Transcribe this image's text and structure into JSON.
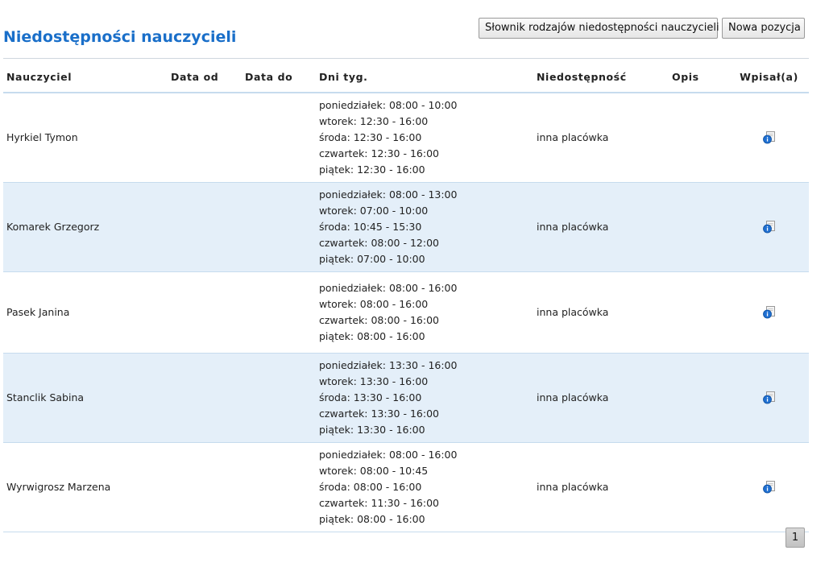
{
  "page": {
    "title": "Niedostępności nauczycieli"
  },
  "toolbar": {
    "dictionary_label": "Słownik rodzajów niedostępności nauczycieli",
    "new_label": "Nowa pozycja"
  },
  "table": {
    "headers": [
      "Nauczyciel",
      "Data od",
      "Data do",
      "Dni tyg.",
      "Niedostępność",
      "Opis",
      "Wpisał(a)"
    ],
    "rows": [
      {
        "teacher": "Hyrkiel Tymon",
        "date_from": "",
        "date_to": "",
        "days": [
          "poniedziałek: 08:00 - 10:00",
          "wtorek: 12:30 - 16:00",
          "środa: 12:30 - 16:00",
          "czwartek: 12:30 - 16:00",
          "piątek: 12:30 - 16:00"
        ],
        "unavailability": "inna placówka",
        "description": "",
        "entered_by_icon": "info-icon"
      },
      {
        "teacher": "Komarek Grzegorz",
        "date_from": "",
        "date_to": "",
        "days": [
          "poniedziałek: 08:00 - 13:00",
          "wtorek: 07:00 - 10:00",
          "środa: 10:45 - 15:30",
          "czwartek: 08:00 - 12:00",
          "piątek: 07:00 - 10:00"
        ],
        "unavailability": "inna placówka",
        "description": "",
        "entered_by_icon": "info-icon"
      },
      {
        "teacher": "Pasek Janina",
        "date_from": "",
        "date_to": "",
        "days": [
          "poniedziałek: 08:00 - 16:00",
          "wtorek: 08:00 - 16:00",
          "czwartek: 08:00 - 16:00",
          "piątek: 08:00 - 16:00"
        ],
        "unavailability": "inna placówka",
        "description": "",
        "entered_by_icon": "info-icon"
      },
      {
        "teacher": "Stanclik Sabina",
        "date_from": "",
        "date_to": "",
        "days": [
          "poniedziałek: 13:30 - 16:00",
          "wtorek: 13:30 - 16:00",
          "środa: 13:30 - 16:00",
          "czwartek: 13:30 - 16:00",
          "piątek: 13:30 - 16:00"
        ],
        "unavailability": "inna placówka",
        "description": "",
        "entered_by_icon": "info-icon"
      },
      {
        "teacher": "Wyrwigrosz Marzena",
        "date_from": "",
        "date_to": "",
        "days": [
          "poniedziałek: 08:00 - 16:00",
          "wtorek: 08:00 - 10:45",
          "środa: 08:00 - 16:00",
          "czwartek: 11:30 - 16:00",
          "piątek: 08:00 - 16:00"
        ],
        "unavailability": "inna placówka",
        "description": "",
        "entered_by_icon": "info-icon"
      }
    ]
  },
  "pagination": {
    "current_page": "1"
  },
  "colors": {
    "title": "#1a6fc9",
    "row_alt_background": "#e4eff9",
    "row_separator": "#c6dbee",
    "info_icon_blue": "#1f6fd1"
  }
}
